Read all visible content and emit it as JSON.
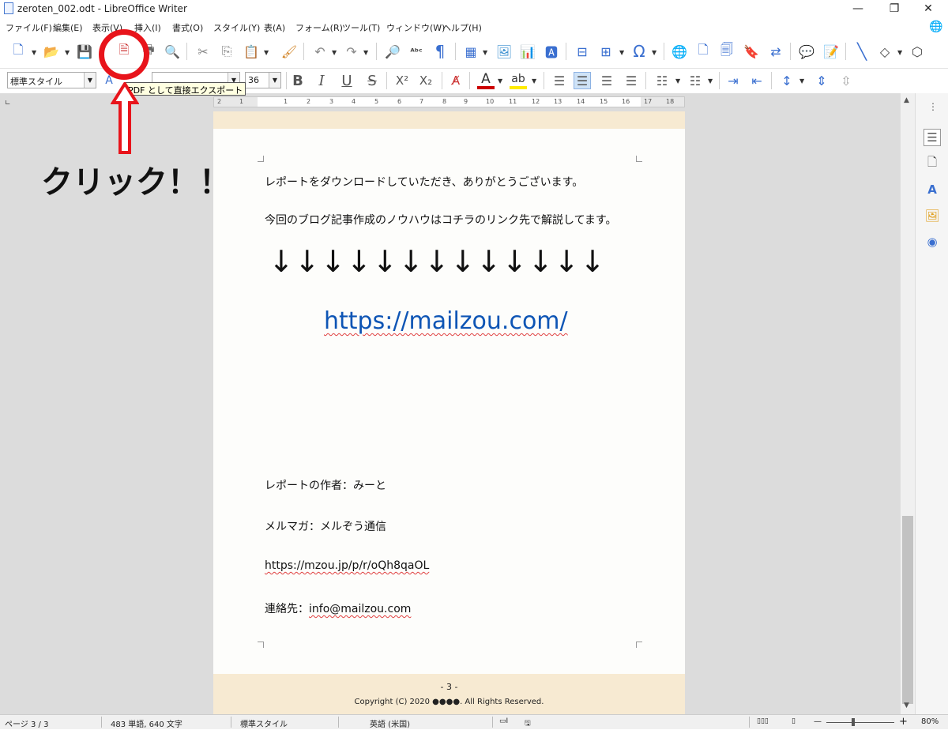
{
  "window": {
    "title": "zeroten_002.odt - LibreOffice Writer",
    "minimize_glyph": "—",
    "restore_glyph": "❐",
    "close_glyph": "✕"
  },
  "menu": [
    "ファイル(F)",
    "編集(E)",
    "表示(V)",
    "挿入(I)",
    "書式(O)",
    "スタイル(Y)",
    "表(A)",
    "フォーム(R)",
    "ツール(T)",
    "ウィンドウ(W)",
    "ヘルプ(H)"
  ],
  "formatting": {
    "paragraph_style": "標準スタイル",
    "font_size": "36",
    "font_name": ""
  },
  "tooltip": "PDF として直接エクスポート",
  "ruler_numbers": [
    "2",
    "1",
    "1",
    "2",
    "3",
    "4",
    "5",
    "6",
    "7",
    "8",
    "9",
    "10",
    "11",
    "12",
    "13",
    "14",
    "15",
    "16",
    "17",
    "18"
  ],
  "annotation": {
    "click_label": "クリック！！",
    "highlight_color": "#e8141b"
  },
  "document": {
    "line1": "レポートをダウンロードしていただき、ありがとうございます。",
    "line2": "今回のブログ記事作成のノウハウはコチラのリンク先で解説してます。",
    "arrows": "↓↓↓↓↓↓↓↓↓↓↓↓↓",
    "link": "https://mailzou.com/",
    "author": "レポートの作者：みーと",
    "newsletter": "メルマガ：メルぞう通信",
    "newsletter_url": "https://mzou.jp/p/r/oQh8qaOL",
    "contact_label": "連絡先：",
    "contact_email": "info@mailzou.com",
    "page_number": "- 3 -",
    "copyright": "Copyright (C) 2020 ●●●●. All Rights Reserved."
  },
  "status": {
    "page": "ページ 3 / 3",
    "words": "483 単語, 640 文字",
    "style": "標準スタイル",
    "language": "英語 (米国)",
    "zoom": "80%"
  },
  "colors": {
    "link": "#0e55b5",
    "header_band": "#f7ead2"
  }
}
